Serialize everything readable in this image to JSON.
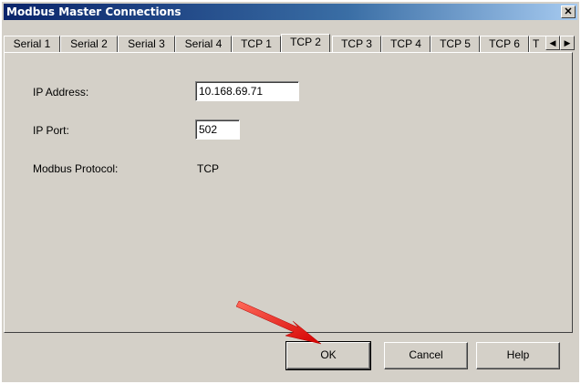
{
  "window": {
    "title": "Modbus Master Connections"
  },
  "tabs": [
    "Serial 1",
    "Serial 2",
    "Serial 3",
    "Serial 4",
    "TCP 1",
    "TCP 2",
    "TCP 3",
    "TCP 4",
    "TCP 5",
    "TCP 6",
    "T"
  ],
  "active_tab": "TCP 2",
  "form": {
    "ip_address_label": "IP Address:",
    "ip_address_value": "10.168.69.71",
    "ip_port_label": "IP Port:",
    "ip_port_value": "502",
    "protocol_label": "Modbus Protocol:",
    "protocol_value": "TCP"
  },
  "buttons": {
    "ok": "OK",
    "cancel": "Cancel",
    "help": "Help"
  },
  "colors": {
    "title_bar": "#0a246a",
    "arrow": "#e02020",
    "dialog_face": "#d4d0c8"
  }
}
